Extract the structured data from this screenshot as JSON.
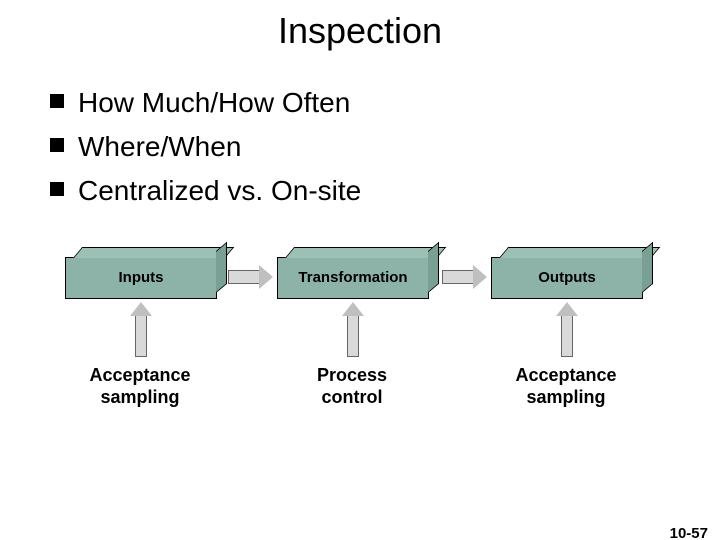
{
  "title": "Inspection",
  "bullets": [
    "How Much/How Often",
    "Where/When",
    "Centralized vs. On-site"
  ],
  "diagram": {
    "boxes": [
      "Inputs",
      "Transformation",
      "Outputs"
    ],
    "below": [
      {
        "line1": "Acceptance",
        "line2": "sampling"
      },
      {
        "line1": "Process",
        "line2": "control"
      },
      {
        "line1": "Acceptance",
        "line2": "sampling"
      }
    ]
  },
  "page_number": "10-57"
}
